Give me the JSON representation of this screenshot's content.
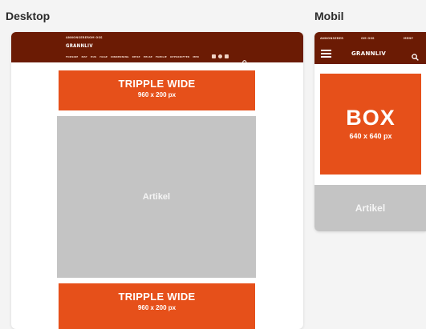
{
  "labels": {
    "desktop": "Desktop",
    "mobile": "Mobil"
  },
  "colors": {
    "header": "#6b1b04",
    "ad": "#e6501a",
    "artikel": "#c4c4c4",
    "background": "#f4f4f4"
  },
  "desktop": {
    "header": {
      "top_links": [
        "ANNONSERER",
        "OM OSS"
      ],
      "logo": "GRANNLIV",
      "nav_items": [
        "FORSIDE",
        "MAT",
        "HUS",
        "HAGE",
        "INNREDNING",
        "REISE",
        "HELSE",
        "FAMILIE",
        "OPPSKRIFTER",
        "MER"
      ],
      "icons": [
        "facebook-icon",
        "instagram-icon",
        "pinterest-icon",
        "search-icon"
      ]
    },
    "ad_top": {
      "title": "TRIPPLE WIDE",
      "size": "960 x 200 px"
    },
    "artikel": {
      "label": "Artikel"
    },
    "ad_bottom": {
      "title": "TRIPPLE WIDE",
      "size": "960 x 200 px"
    }
  },
  "mobile": {
    "header": {
      "top_links": [
        "ANNONSERER",
        "OM OSS",
        "MENY"
      ],
      "logo": "GRANNLIV",
      "icons": [
        "hamburger-menu-icon",
        "search-icon"
      ]
    },
    "ad": {
      "title": "BOX",
      "size": "640 x 640 px"
    },
    "artikel": {
      "label": "Artikel"
    }
  }
}
